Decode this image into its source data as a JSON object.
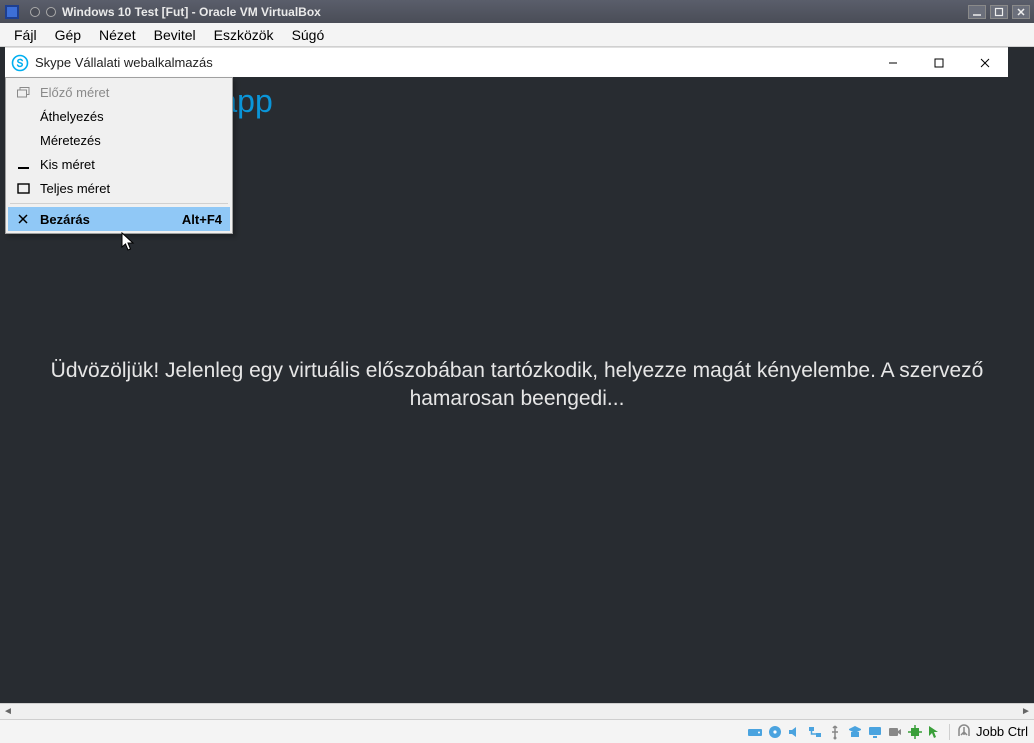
{
  "virtualbox": {
    "title": "Windows 10 Test [Fut] - Oracle VM VirtualBox",
    "menu": [
      "Fájl",
      "Gép",
      "Nézet",
      "Bevitel",
      "Eszközök",
      "Súgó"
    ],
    "status": {
      "host_key": "Jobb Ctrl",
      "icons": [
        "hd-icon",
        "cd-icon",
        "audio-icon",
        "net-icon",
        "usb-icon",
        "shared-icon",
        "display-icon",
        "rec-icon",
        "cpu-icon",
        "mouse-icon"
      ]
    }
  },
  "skype": {
    "title": "Skype Vállalati webalkalmazás",
    "header_partial": "etek app",
    "welcome": "Üdvözöljük! Jelenleg egy virtuális előszobában tartózkodik, helyezze magát kényelembe. A szervező hamarosan beengedi..."
  },
  "system_menu": {
    "items": [
      {
        "icon": "restore-icon",
        "label": "Előző méret",
        "enabled": false,
        "shortcut": ""
      },
      {
        "icon": "",
        "label": "Áthelyezés",
        "enabled": true,
        "shortcut": ""
      },
      {
        "icon": "",
        "label": "Méretezés",
        "enabled": true,
        "shortcut": ""
      },
      {
        "icon": "minimize-icon",
        "label": "Kis méret",
        "enabled": true,
        "shortcut": ""
      },
      {
        "icon": "maximize-icon",
        "label": "Teljes méret",
        "enabled": true,
        "shortcut": ""
      }
    ],
    "separator_after": 4,
    "close": {
      "icon": "close-icon",
      "label": "Bezárás",
      "enabled": true,
      "shortcut": "Alt+F4",
      "highlight": true
    }
  }
}
